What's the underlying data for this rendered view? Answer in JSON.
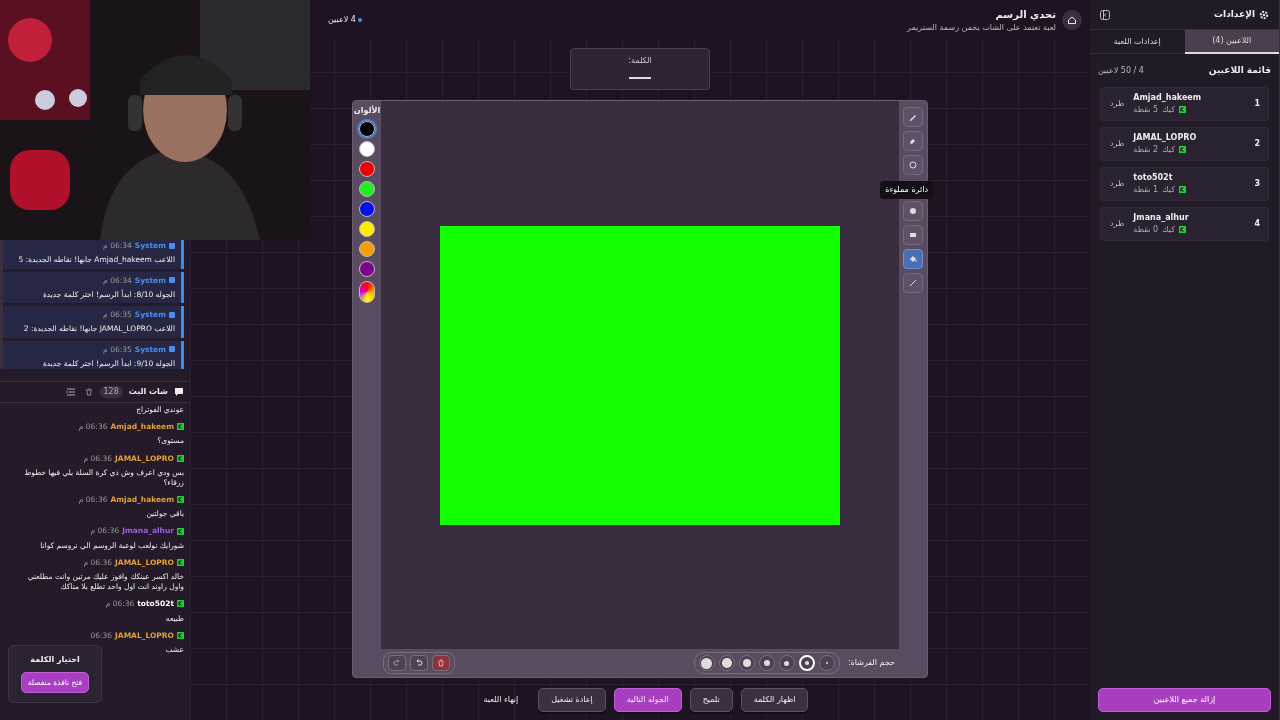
{
  "header": {
    "title": "تحدي الرسم",
    "subtitle": "لعبة تعتمد على الشات يخمن رسمة الستريمر",
    "players_count": "4 لاعبين"
  },
  "word": {
    "label": "الكلمة:"
  },
  "palette": {
    "title": "الألوان",
    "colors": [
      {
        "kind": "swatch",
        "color": "#000000",
        "selected": true
      },
      {
        "kind": "swatch",
        "color": "#ffffff",
        "selected": false
      },
      {
        "kind": "swatch",
        "color": "#ee0000",
        "selected": false
      },
      {
        "kind": "swatch",
        "color": "#22ee22",
        "selected": false
      },
      {
        "kind": "swatch",
        "color": "#0011ee",
        "selected": false
      },
      {
        "kind": "swatch",
        "color": "#ffee00",
        "selected": false
      },
      {
        "kind": "swatch",
        "color": "#f5a000",
        "selected": false
      },
      {
        "kind": "swatch",
        "color": "#800090",
        "selected": false
      },
      {
        "kind": "picker",
        "selected": false
      }
    ]
  },
  "tools": [
    {
      "kind": "pencil",
      "selected": false
    },
    {
      "kind": "eraser",
      "selected": false
    },
    {
      "kind": "circle",
      "selected": false
    },
    {
      "kind": "filled_circle",
      "selected": false,
      "tooltip": "دائرة مملوءة"
    },
    {
      "kind": "rectangle",
      "selected": false
    },
    {
      "kind": "fill",
      "selected": true
    },
    {
      "kind": "line",
      "selected": false
    }
  ],
  "drawing": {
    "shapes": [
      {
        "kind": "filled_rect"
      }
    ]
  },
  "brush": {
    "label": "حجم الفرشاة:",
    "sizes": [
      {
        "selected": false
      },
      {
        "selected": true
      },
      {
        "selected": false
      },
      {
        "selected": false
      },
      {
        "selected": false
      },
      {
        "selected": false
      },
      {
        "selected": false
      }
    ]
  },
  "canvas_actions": [
    {
      "kind": "clear"
    },
    {
      "kind": "undo"
    },
    {
      "kind": "redo"
    }
  ],
  "controls": [
    {
      "kind": "secondary",
      "label": "اظهار الكلمة"
    },
    {
      "kind": "secondary",
      "label": "تلميح"
    },
    {
      "kind": "primary",
      "label": "الجوله التالية"
    },
    {
      "kind": "secondary",
      "label": "إعادة تشغيل"
    },
    {
      "kind": "link",
      "label": "إنهاء اللعبة"
    }
  ],
  "settings": {
    "title": "الإعدادات",
    "tabs": [
      {
        "label": "اللاعبين (4)",
        "selected": true
      },
      {
        "label": "إعدادات اللعبة",
        "selected": false
      }
    ],
    "list_title": "قائمة اللاعبين",
    "capacity": "4 / 50 لاعبين",
    "players": [
      {
        "rank": "1",
        "name": "Amjad_hakeem",
        "platform": "كيك",
        "points": "5 نقطة",
        "action": "طرد"
      },
      {
        "rank": "2",
        "name": "JAMAL_LOPRO",
        "platform": "كيك",
        "points": "2 نقطة",
        "action": "طرد"
      },
      {
        "rank": "3",
        "name": "toto502t",
        "platform": "كيك",
        "points": "1 نقطة",
        "action": "طرد"
      },
      {
        "rank": "4",
        "name": "Jmana_alhur",
        "platform": "كيك",
        "points": "0 نقطة",
        "action": "طرد"
      }
    ],
    "remove_all": "إزالة جميع اللاعبين"
  },
  "system_log": [
    {
      "sender": "System",
      "time": "06:34 م",
      "text": "اللاعب Amjad_hakeem جابها! نقاطه الجديدة: 5"
    },
    {
      "sender": "System",
      "time": "06:34 م",
      "text": "الجوله 8/10: ابدأ الرسم! اختر كلمة جديدة"
    },
    {
      "sender": "System",
      "time": "06:35 م",
      "text": "اللاعب JAMAL_LOPRO جابها! نقاطه الجديدة: 2"
    },
    {
      "sender": "System",
      "time": "06:35 م",
      "text": "الجوله 9/10: ابدأ الرسم! اختر كلمة جديدة"
    }
  ],
  "chat": {
    "title": "شات البث",
    "count": "128",
    "messages": [
      {
        "kind": "continuation",
        "text": "عوندي الفوتراج"
      },
      {
        "kind": "message",
        "user": "Amjad_hakeem",
        "color": "#e2a23a",
        "time": "06:36 م",
        "text": "مستوى؟"
      },
      {
        "kind": "message",
        "user": "JAMAL_LOPRO",
        "color": "#e2a23a",
        "time": "06:36 م",
        "text": "بس ودي اعرف وش ذي كرة السلة يلي فيها خطوط زرقاء؟"
      },
      {
        "kind": "message",
        "user": "Amjad_hakeem",
        "color": "#e2a23a",
        "time": "06:36 م",
        "text": "باقي جولتين"
      },
      {
        "kind": "message",
        "user": "Jmana_alhur",
        "color": "#a25ce8",
        "time": "06:36 م",
        "text": "شورايك نولعب لوعبة الروسم الي نروسم كوانا"
      },
      {
        "kind": "message",
        "user": "JAMAL_LOPRO",
        "color": "#e2a23a",
        "time": "06:36 م",
        "text": "خالد اكسر عينكك وافوز عليك مرتين وانت مطلعني واول راوند انت اول واحد تطلع بلا مناكك"
      },
      {
        "kind": "message",
        "user": "toto502t",
        "color": "#ffffff",
        "time": "06:36 م",
        "text": "طبيعه"
      },
      {
        "kind": "message",
        "user": "JAMAL_LOPRO",
        "color": "#e2a23a",
        "time": "06:36",
        "text": "عشب"
      }
    ]
  },
  "word_choice": {
    "title": "اختيار الكلمة",
    "button": "فتح نافذة منفصلة"
  }
}
